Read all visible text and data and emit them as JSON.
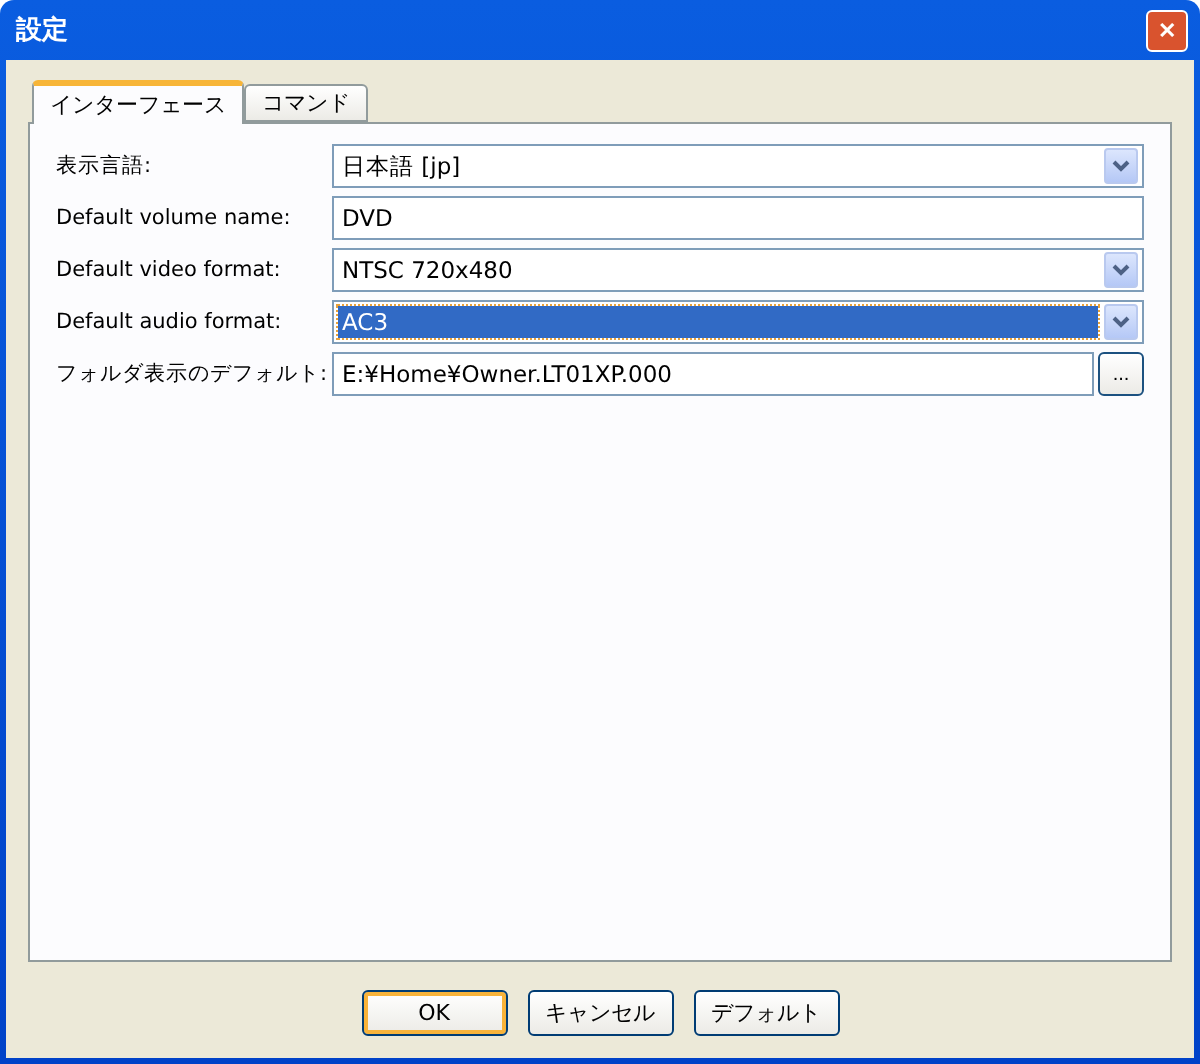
{
  "window": {
    "title": "設定",
    "close": "✕"
  },
  "tabs": [
    {
      "label": "インターフェース",
      "selected": true
    },
    {
      "label": "コマンド",
      "selected": false
    }
  ],
  "fields": [
    {
      "label": "表示言語:",
      "kind": "select",
      "value": "日本語 [jp]",
      "focused": false
    },
    {
      "label": "Default volume name:",
      "kind": "text",
      "value": "DVD",
      "focused": false
    },
    {
      "label": "Default video format:",
      "kind": "select",
      "value": "NTSC 720x480",
      "focused": false
    },
    {
      "label": "Default audio format:",
      "kind": "select",
      "value": "AC3",
      "focused": true
    },
    {
      "label": "フォルダ表示のデフォルト:",
      "kind": "browse",
      "value": "E:¥Home¥Owner.LT01XP.000",
      "button": "..."
    }
  ],
  "buttons": [
    {
      "label": "OK",
      "default": true
    },
    {
      "label": "キャンセル",
      "default": false
    },
    {
      "label": "デフォルト",
      "default": false
    }
  ]
}
